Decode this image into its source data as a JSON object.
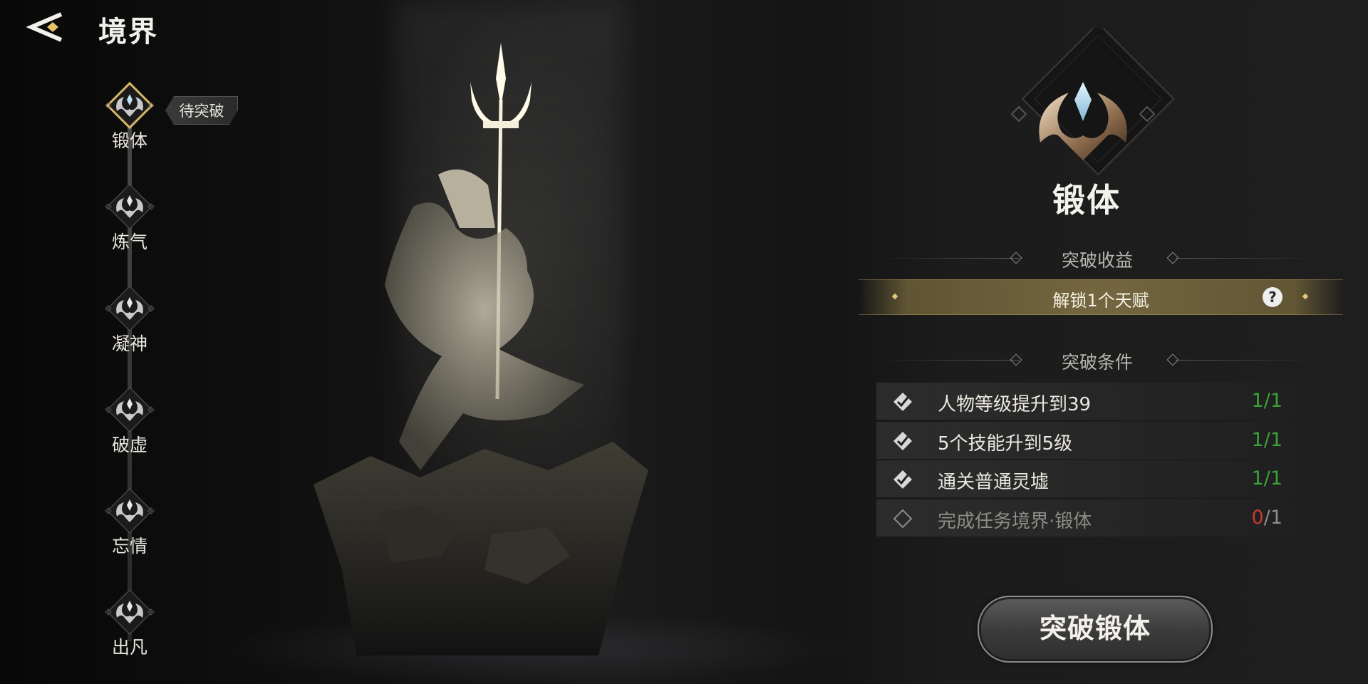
{
  "header": {
    "title": "境界"
  },
  "realms": [
    {
      "label": "锻体",
      "icon": "realm-emblem-icon",
      "selected": true
    },
    {
      "label": "炼气",
      "icon": "realm-emblem-icon"
    },
    {
      "label": "凝神",
      "icon": "realm-emblem-icon"
    },
    {
      "label": "破虚",
      "icon": "realm-emblem-icon"
    },
    {
      "label": "忘情",
      "icon": "realm-emblem-icon"
    },
    {
      "label": "出凡",
      "icon": "realm-emblem-icon"
    }
  ],
  "current_badge": "待突破",
  "detail": {
    "realm_name": "锻体",
    "reward_section_title": "突破收益",
    "reward_text": "解锁1个天赋",
    "help_label": "?",
    "condition_section_title": "突破条件",
    "conditions": [
      {
        "text": "人物等级提升到39",
        "current": "1",
        "sep": "/",
        "total": "1",
        "done": true
      },
      {
        "text": "5个技能升到5级",
        "current": "1",
        "sep": "/",
        "total": "1",
        "done": true
      },
      {
        "text": "通关普通灵墟",
        "current": "1",
        "sep": "/",
        "total": "1",
        "done": true
      },
      {
        "text": "完成任务境界·锻体",
        "current": "0",
        "sep": "/",
        "total": "1",
        "done": false
      }
    ],
    "action_button": "突破锻体"
  },
  "colors": {
    "accent_gold": "#d6b76a",
    "progress_done": "#3aa23a",
    "progress_missing": "#c43a34"
  }
}
